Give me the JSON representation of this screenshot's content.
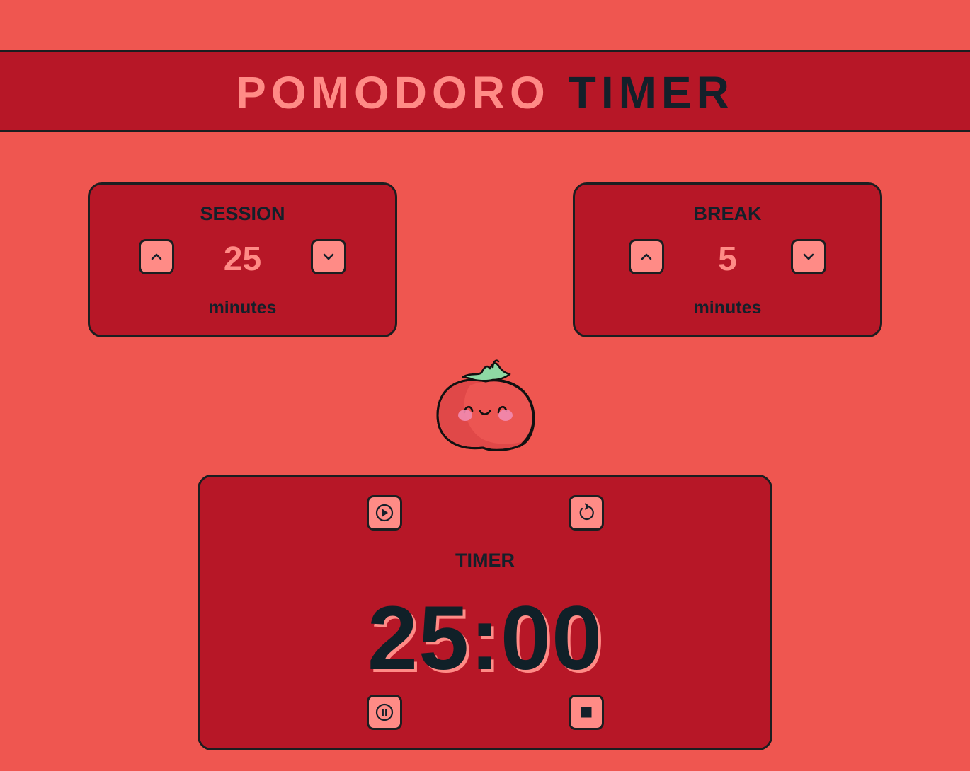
{
  "header": {
    "title_word1": "POMODORO",
    "title_word2": "TIMER"
  },
  "session": {
    "label": "SESSION",
    "value": "25",
    "unit": "minutes",
    "increase_icon": "chevron-up-icon",
    "decrease_icon": "chevron-down-icon"
  },
  "break": {
    "label": "BREAK",
    "value": "5",
    "unit": "minutes",
    "increase_icon": "chevron-up-icon",
    "decrease_icon": "chevron-down-icon"
  },
  "mascot": {
    "icon": "tomato-mascot-icon"
  },
  "timer": {
    "label": "TIMER",
    "time": "25:00",
    "controls": {
      "play_icon": "play-circle-icon",
      "restart_icon": "restart-icon",
      "pause_icon": "pause-circle-icon",
      "stop_icon": "stop-square-icon"
    }
  },
  "colors": {
    "background": "#ef5650",
    "panel": "#b71727",
    "accent": "#ff8b86",
    "dark": "#14202a",
    "border": "#1b1e20",
    "leaf": "#8ed9a4",
    "blush": "#f28bb0"
  }
}
